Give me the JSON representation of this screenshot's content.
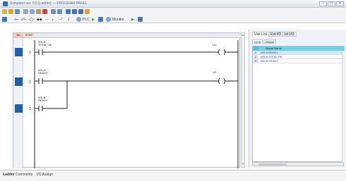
{
  "window": {
    "title": "Simulator ver. 5.0 [Ladder] — PROGRAM PANEL",
    "controls": [
      "–",
      "▢",
      "✕"
    ]
  },
  "toolbar2": {
    "plc_label": "PLC",
    "monitor_label": "Monitor"
  },
  "ladder": {
    "header": {
      "no": "No",
      "step": "STEP"
    },
    "rungs": [
      {
        "number": "1",
        "contact_label": "WS-A\nTOTAL OK",
        "coil_label": "U1"
      },
      {
        "number": "2",
        "contact_label": "WS-A\nREADY",
        "coil_label": "U2"
      },
      {
        "number": "3",
        "contact_label": "WS-B\nREADY",
        "coil_label": ""
      }
    ]
  },
  "side_panel": {
    "tabs": [
      "Use List",
      "Ext I/O",
      "Int I/O"
    ],
    "active_tab": "Use List",
    "sub_tabs": [
      "Input",
      "Output"
    ],
    "active_sub_tab": "Input",
    "table": {
      "header": "Signal Name",
      "rows": [
        {
          "num": "1",
          "name": "WS-A READY"
        },
        {
          "num": "2",
          "name": "WS-A TOTAL OK"
        },
        {
          "num": "3",
          "name": "WS-B READY"
        }
      ]
    }
  },
  "bottom_tabs": [
    "Ladder",
    "Comments",
    "I/O Assign"
  ],
  "colors": {
    "accent": "#1f5fae",
    "grid_header": "#6ecfe6"
  }
}
